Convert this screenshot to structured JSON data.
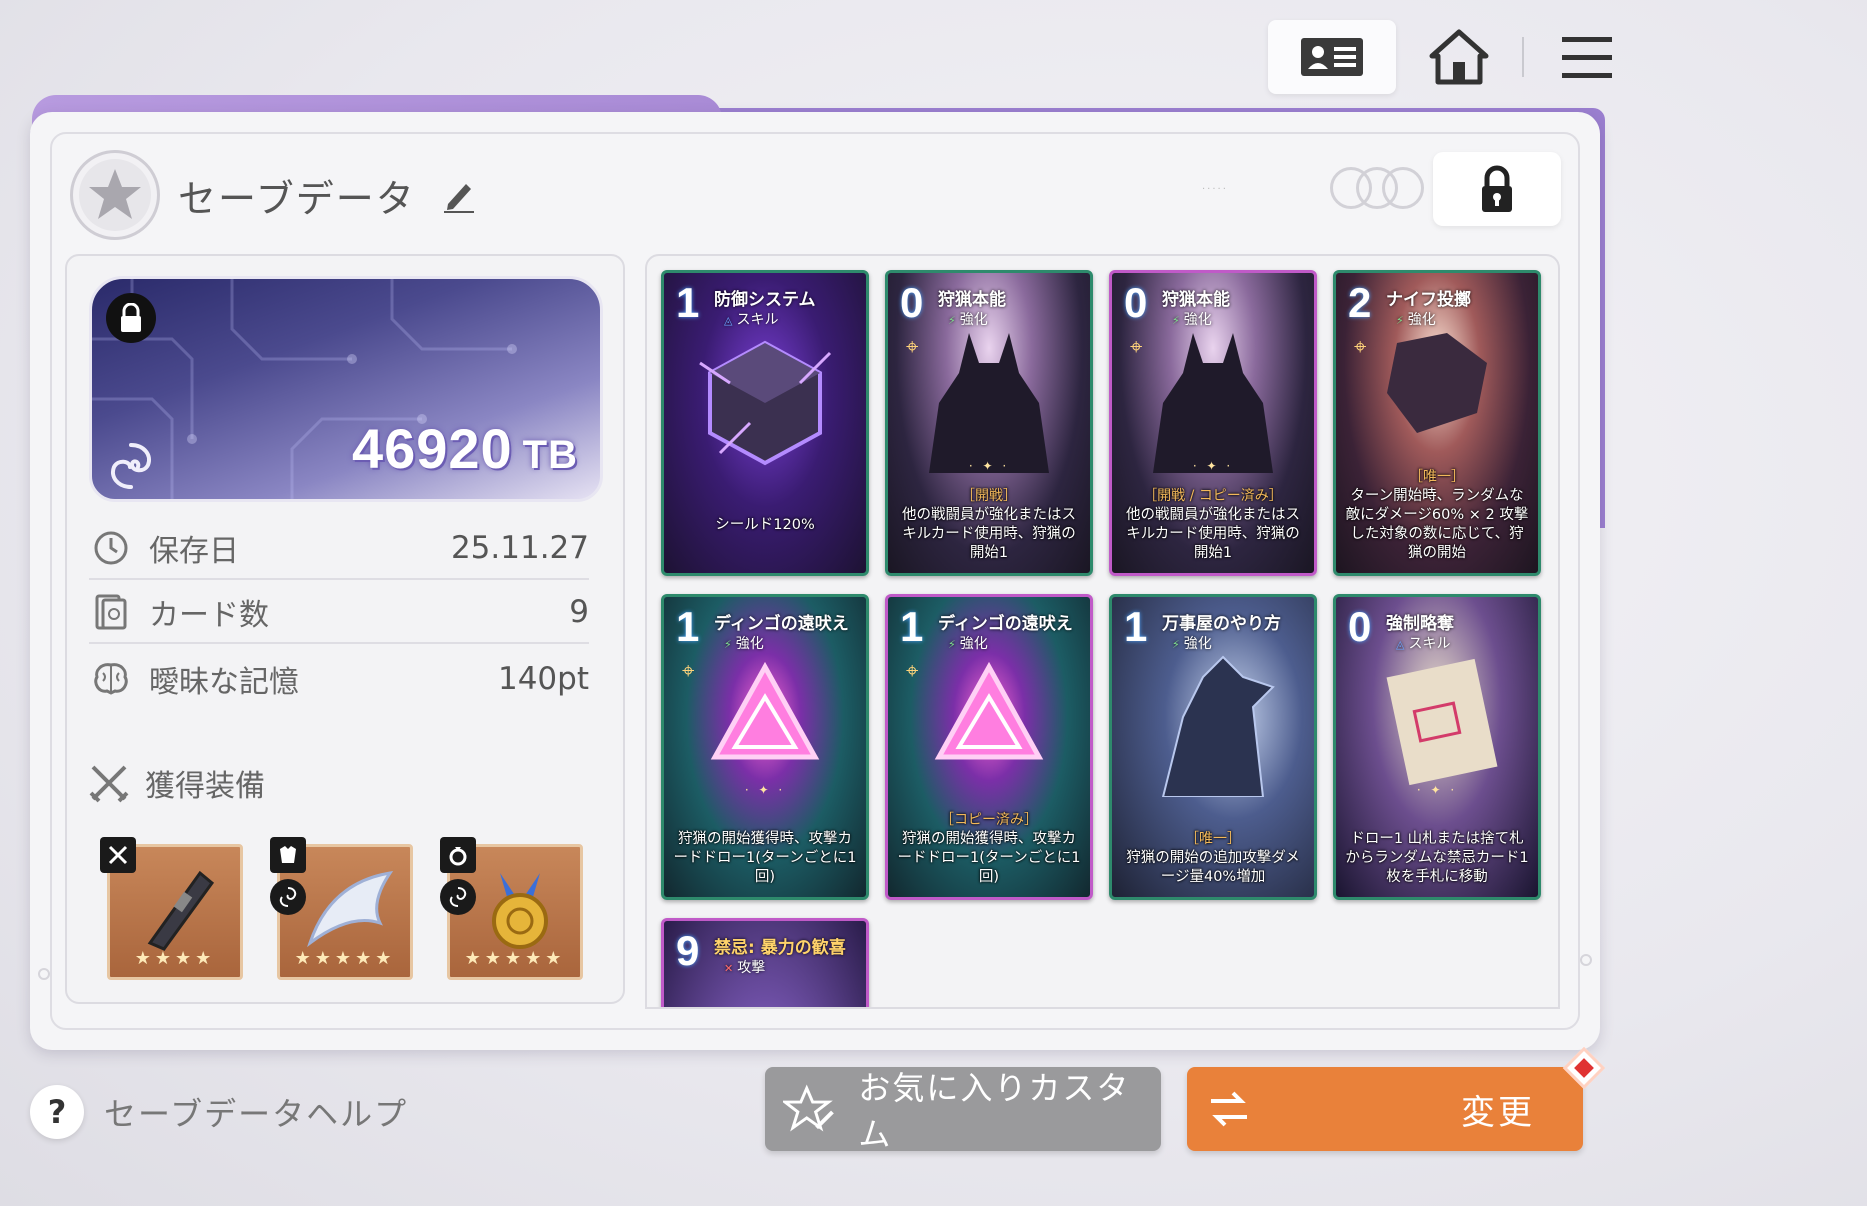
{
  "header": {
    "title": "セーブデータ"
  },
  "currency": {
    "value": "46920",
    "unit": "TB"
  },
  "stats": [
    {
      "icon": "clock-icon",
      "label": "保存日",
      "value": "25.11.27"
    },
    {
      "icon": "card-icon",
      "label": "カード数",
      "value": "9"
    },
    {
      "icon": "brain-icon",
      "label": "曖昧な記憶",
      "value": "140pt"
    }
  ],
  "equipment": {
    "title": "獲得装備",
    "items": [
      {
        "name": "gauntlet",
        "stars": "★★★★"
      },
      {
        "name": "feather-cloak",
        "stars": "★★★★★"
      },
      {
        "name": "gold-medal",
        "stars": "★★★★★"
      }
    ]
  },
  "cards": [
    {
      "cost": "1",
      "name": "防御システム",
      "type": "スキル",
      "tag": "",
      "desc": "シールド120%"
    },
    {
      "cost": "0",
      "name": "狩猟本能",
      "type": "強化",
      "tag": "［開戦］",
      "desc": "他の戦闘員が強化またはスキルカード使用時、狩猟の開始1"
    },
    {
      "cost": "0",
      "name": "狩猟本能",
      "type": "強化",
      "tag": "［開戦 / コピー済み］",
      "desc": "他の戦闘員が強化またはスキルカード使用時、狩猟の開始1"
    },
    {
      "cost": "2",
      "name": "ナイフ投擲",
      "type": "強化",
      "tag": "［唯一］",
      "desc": "ターン開始時、ランダムな敵にダメージ60% × 2 攻撃した対象の数に応じて、狩猟の開始"
    },
    {
      "cost": "1",
      "name": "ディンゴの遠吠え",
      "type": "強化",
      "tag": "",
      "desc": "狩猟の開始獲得時、攻撃カードドロー1(ターンごとに1回)"
    },
    {
      "cost": "1",
      "name": "ディンゴの遠吠え",
      "type": "強化",
      "tag": "［コピー済み］",
      "desc": "狩猟の開始獲得時、攻撃カードドロー1(ターンごとに1回)"
    },
    {
      "cost": "1",
      "name": "万事屋のやり方",
      "type": "強化",
      "tag": "［唯一］",
      "desc": "狩猟の開始の追加攻撃ダメージ量40%増加"
    },
    {
      "cost": "0",
      "name": "強制略奪",
      "type": "スキル",
      "tag": "",
      "desc": "ドロー1 山札または捨て札からランダムな禁忌カード1枚を手札に移動"
    },
    {
      "cost": "9",
      "name": "禁忌: 暴力の歓喜",
      "type": "攻撃",
      "tag": "",
      "desc": ""
    }
  ],
  "footer": {
    "help_label": "セーブデータヘルプ",
    "favorite_label": "お気に入りカスタム",
    "change_label": "変更"
  }
}
